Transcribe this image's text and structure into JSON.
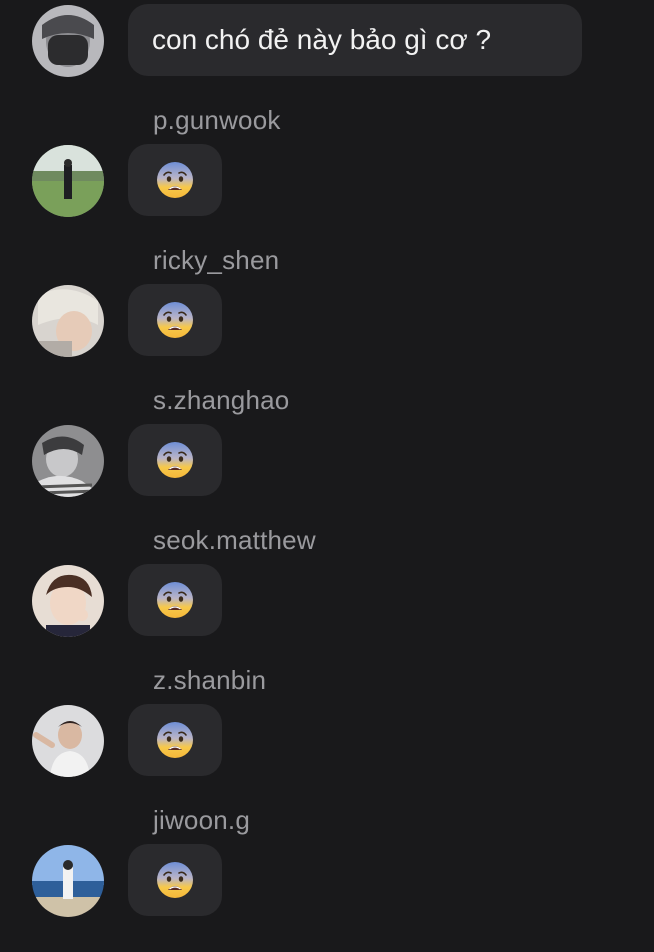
{
  "first_message": {
    "text": "con chó đẻ này bảo gì cơ ?"
  },
  "replies": [
    {
      "username": "p.gunwook",
      "reaction": "fearful-face-emoji"
    },
    {
      "username": "ricky_shen",
      "reaction": "fearful-face-emoji"
    },
    {
      "username": "s.zhanghao",
      "reaction": "fearful-face-emoji"
    },
    {
      "username": "seok.matthew",
      "reaction": "fearful-face-emoji"
    },
    {
      "username": "z.shanbin",
      "reaction": "fearful-face-emoji"
    },
    {
      "username": "jiwoon.g",
      "reaction": "fearful-face-emoji"
    }
  ],
  "colors": {
    "background": "#19191b",
    "bubble": "#2a2a2d",
    "username": "#9a9a9e",
    "text": "#f2f2f2"
  }
}
